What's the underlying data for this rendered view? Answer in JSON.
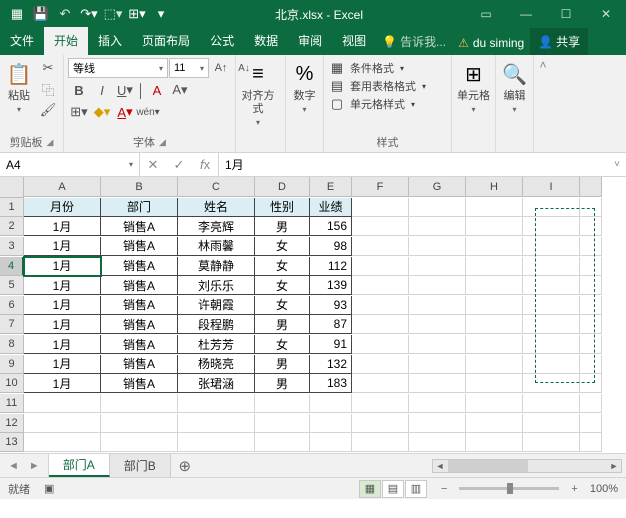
{
  "title": "北京.xlsx - Excel",
  "tabs": {
    "file": "文件",
    "home": "开始",
    "insert": "插入",
    "layout": "页面布局",
    "formulas": "公式",
    "data": "数据",
    "review": "审阅",
    "view": "视图",
    "tell": "告诉我...",
    "user": "du siming",
    "share": "共享"
  },
  "ribbon": {
    "clipboard": {
      "paste": "粘贴",
      "label": "剪贴板"
    },
    "font": {
      "name": "等线",
      "size": "11",
      "label": "字体"
    },
    "align": {
      "label": "对齐方式"
    },
    "number": {
      "symbol": "%",
      "label": "数字"
    },
    "styles": {
      "cond": "条件格式",
      "table": "套用表格格式",
      "cell": "单元格样式",
      "label": "样式"
    },
    "cells": {
      "label": "单元格"
    },
    "edit": {
      "label": "编辑"
    }
  },
  "name_box": "A4",
  "formula": "1月",
  "columns": [
    "A",
    "B",
    "C",
    "D",
    "E",
    "F",
    "G",
    "H",
    "I"
  ],
  "headers": [
    "月份",
    "部门",
    "姓名",
    "性别",
    "业绩"
  ],
  "rows": [
    [
      "1月",
      "销售A",
      "李亮辉",
      "男",
      "156"
    ],
    [
      "1月",
      "销售A",
      "林雨馨",
      "女",
      "98"
    ],
    [
      "1月",
      "销售A",
      "莫静静",
      "女",
      "112"
    ],
    [
      "1月",
      "销售A",
      "刘乐乐",
      "女",
      "139"
    ],
    [
      "1月",
      "销售A",
      "许朝霞",
      "女",
      "93"
    ],
    [
      "1月",
      "销售A",
      "段程鹏",
      "男",
      "87"
    ],
    [
      "1月",
      "销售A",
      "杜芳芳",
      "女",
      "91"
    ],
    [
      "1月",
      "销售A",
      "杨晓亮",
      "男",
      "132"
    ],
    [
      "1月",
      "销售A",
      "张珺涵",
      "男",
      "183"
    ]
  ],
  "sheets": {
    "a": "部门A",
    "b": "部门B"
  },
  "status": {
    "ready": "就绪",
    "zoom": "100%"
  }
}
